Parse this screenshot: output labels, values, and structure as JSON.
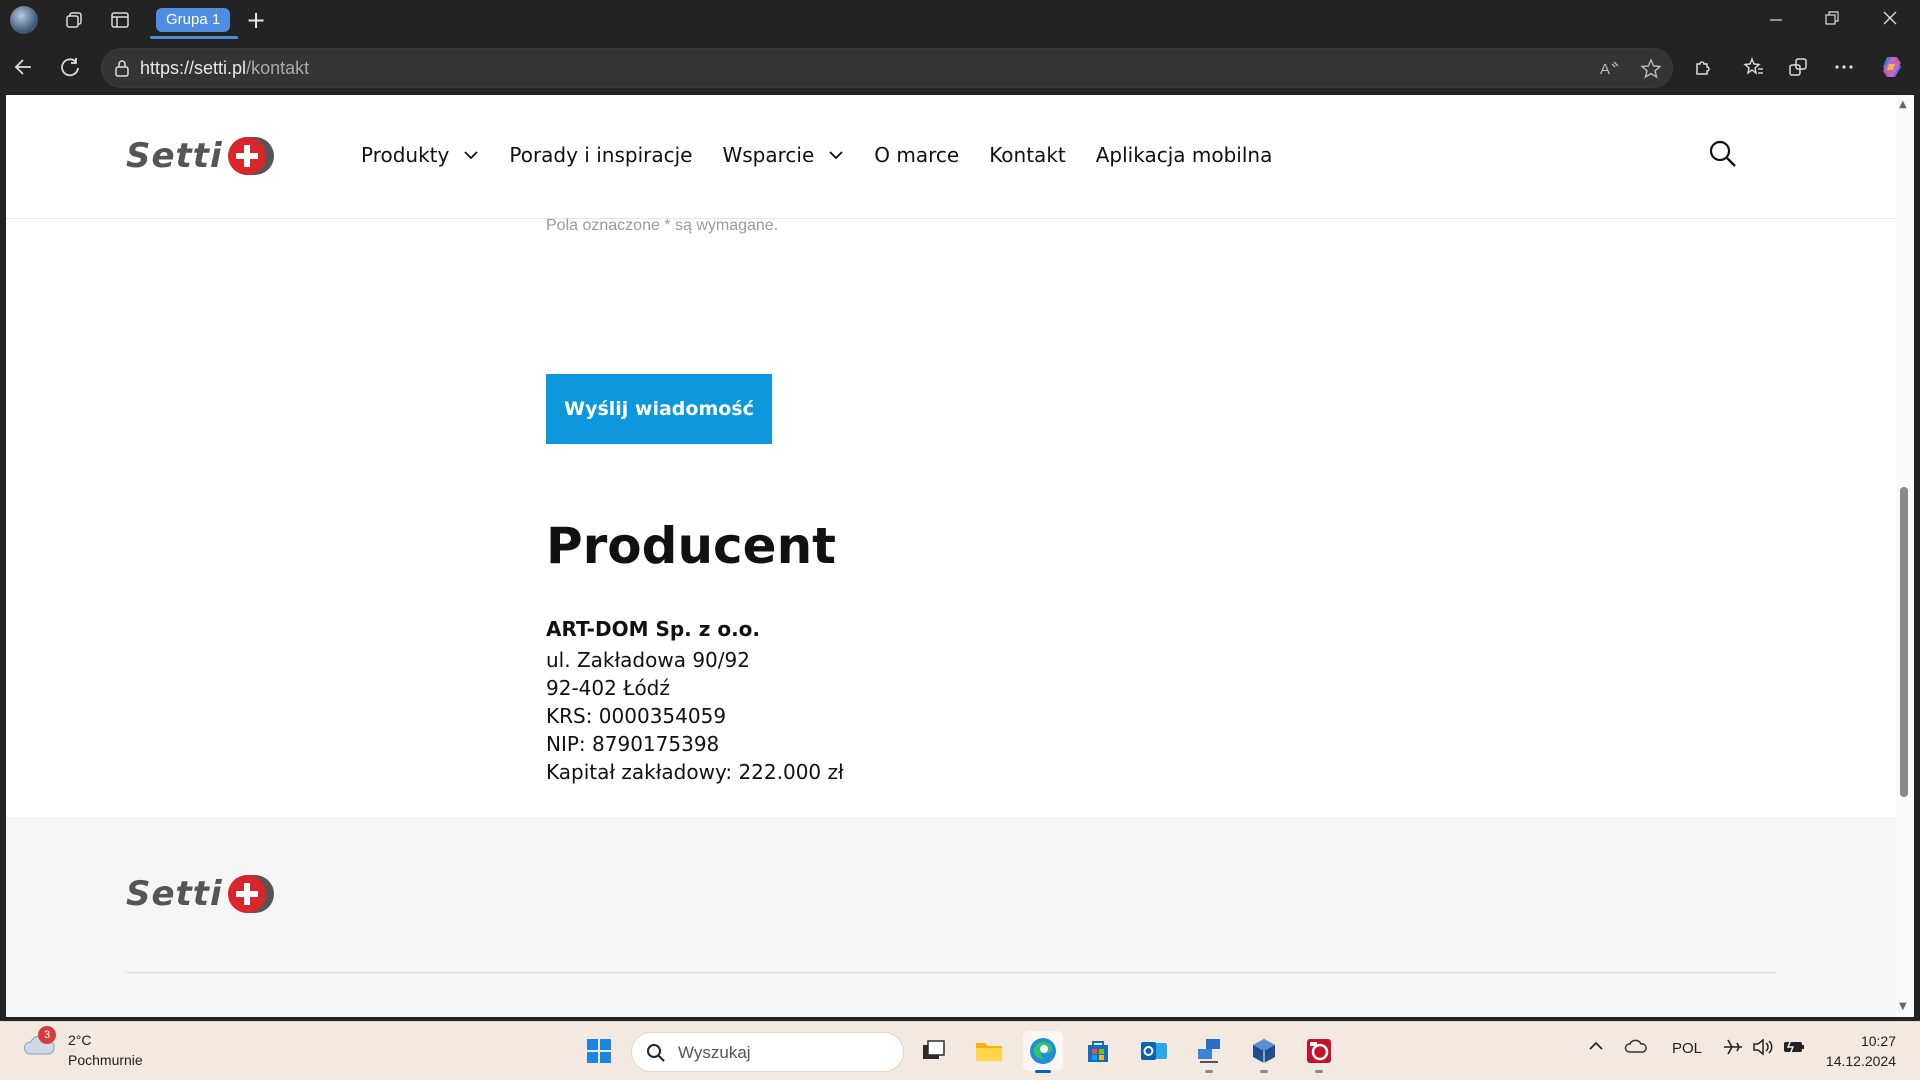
{
  "browser": {
    "tab_group_label": "Grupa 1",
    "url_host": "https://setti.pl",
    "url_path": "/kontakt"
  },
  "site": {
    "logo_text": "Setti",
    "nav": [
      {
        "label": "Produkty",
        "has_dropdown": true
      },
      {
        "label": "Porady i inspiracje",
        "has_dropdown": false
      },
      {
        "label": "Wsparcie",
        "has_dropdown": true
      },
      {
        "label": "O marce",
        "has_dropdown": false
      },
      {
        "label": "Kontakt",
        "has_dropdown": false
      },
      {
        "label": "Aplikacja mobilna",
        "has_dropdown": false
      }
    ]
  },
  "form": {
    "required_note": "Pola oznaczone * są wymagane.",
    "submit_label": "Wyślij wiadomość"
  },
  "producer": {
    "title": "Producent",
    "company": "ART-DOM Sp. z o.o.",
    "street": "ul. Zakładowa 90/92",
    "city": "92-402 Łódź",
    "krs": "KRS: 0000354059",
    "nip": "NIP: 8790175398",
    "capital": "Kapitał zakładowy: 222.000 zł"
  },
  "colors": {
    "accent": "#0d97dc",
    "logo_red": "#d9262b"
  },
  "taskbar": {
    "weather_badge": "3",
    "temperature": "2°C",
    "weather_desc": "Pochmurnie",
    "search_placeholder": "Wyszukaj",
    "language": "POL",
    "time": "10:27",
    "date": "14.12.2024"
  }
}
